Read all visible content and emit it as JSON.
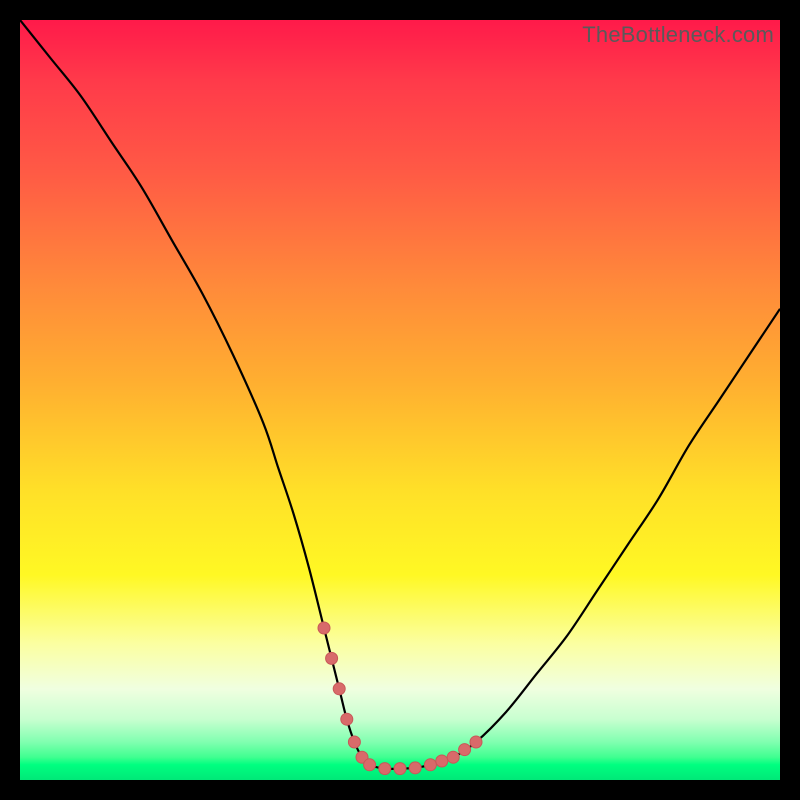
{
  "watermark": "TheBottleneck.com",
  "colors": {
    "curve": "#000000",
    "marker_fill": "#d86a6a",
    "marker_stroke": "#c85858"
  },
  "chart_data": {
    "type": "line",
    "title": "",
    "xlabel": "",
    "ylabel": "",
    "xlim": [
      0,
      100
    ],
    "ylim": [
      0,
      100
    ],
    "series": [
      {
        "name": "bottleneck-curve",
        "x": [
          0,
          4,
          8,
          12,
          16,
          20,
          24,
          28,
          32,
          34,
          36,
          38,
          40,
          42,
          43,
          44,
          45,
          46,
          48,
          50,
          52,
          54,
          57,
          60,
          64,
          68,
          72,
          76,
          80,
          84,
          88,
          92,
          96,
          100
        ],
        "values": [
          100,
          95,
          90,
          84,
          78,
          71,
          64,
          56,
          47,
          41,
          35,
          28,
          20,
          12,
          8,
          5,
          3,
          2,
          1.5,
          1.5,
          1.6,
          2,
          3,
          5,
          9,
          14,
          19,
          25,
          31,
          37,
          44,
          50,
          56,
          62
        ]
      }
    ],
    "markers": {
      "name": "trough-markers",
      "x": [
        40.0,
        41.0,
        42.0,
        43.0,
        44.0,
        45.0,
        46.0,
        48.0,
        50.0,
        52.0,
        54.0,
        55.5,
        57.0,
        58.5,
        60.0
      ],
      "values": [
        20.0,
        16.0,
        12.0,
        8.0,
        5.0,
        3.0,
        2.0,
        1.5,
        1.5,
        1.6,
        2.0,
        2.5,
        3.0,
        4.0,
        5.0
      ],
      "radius_px": 6
    },
    "grid": false,
    "legend": false
  }
}
